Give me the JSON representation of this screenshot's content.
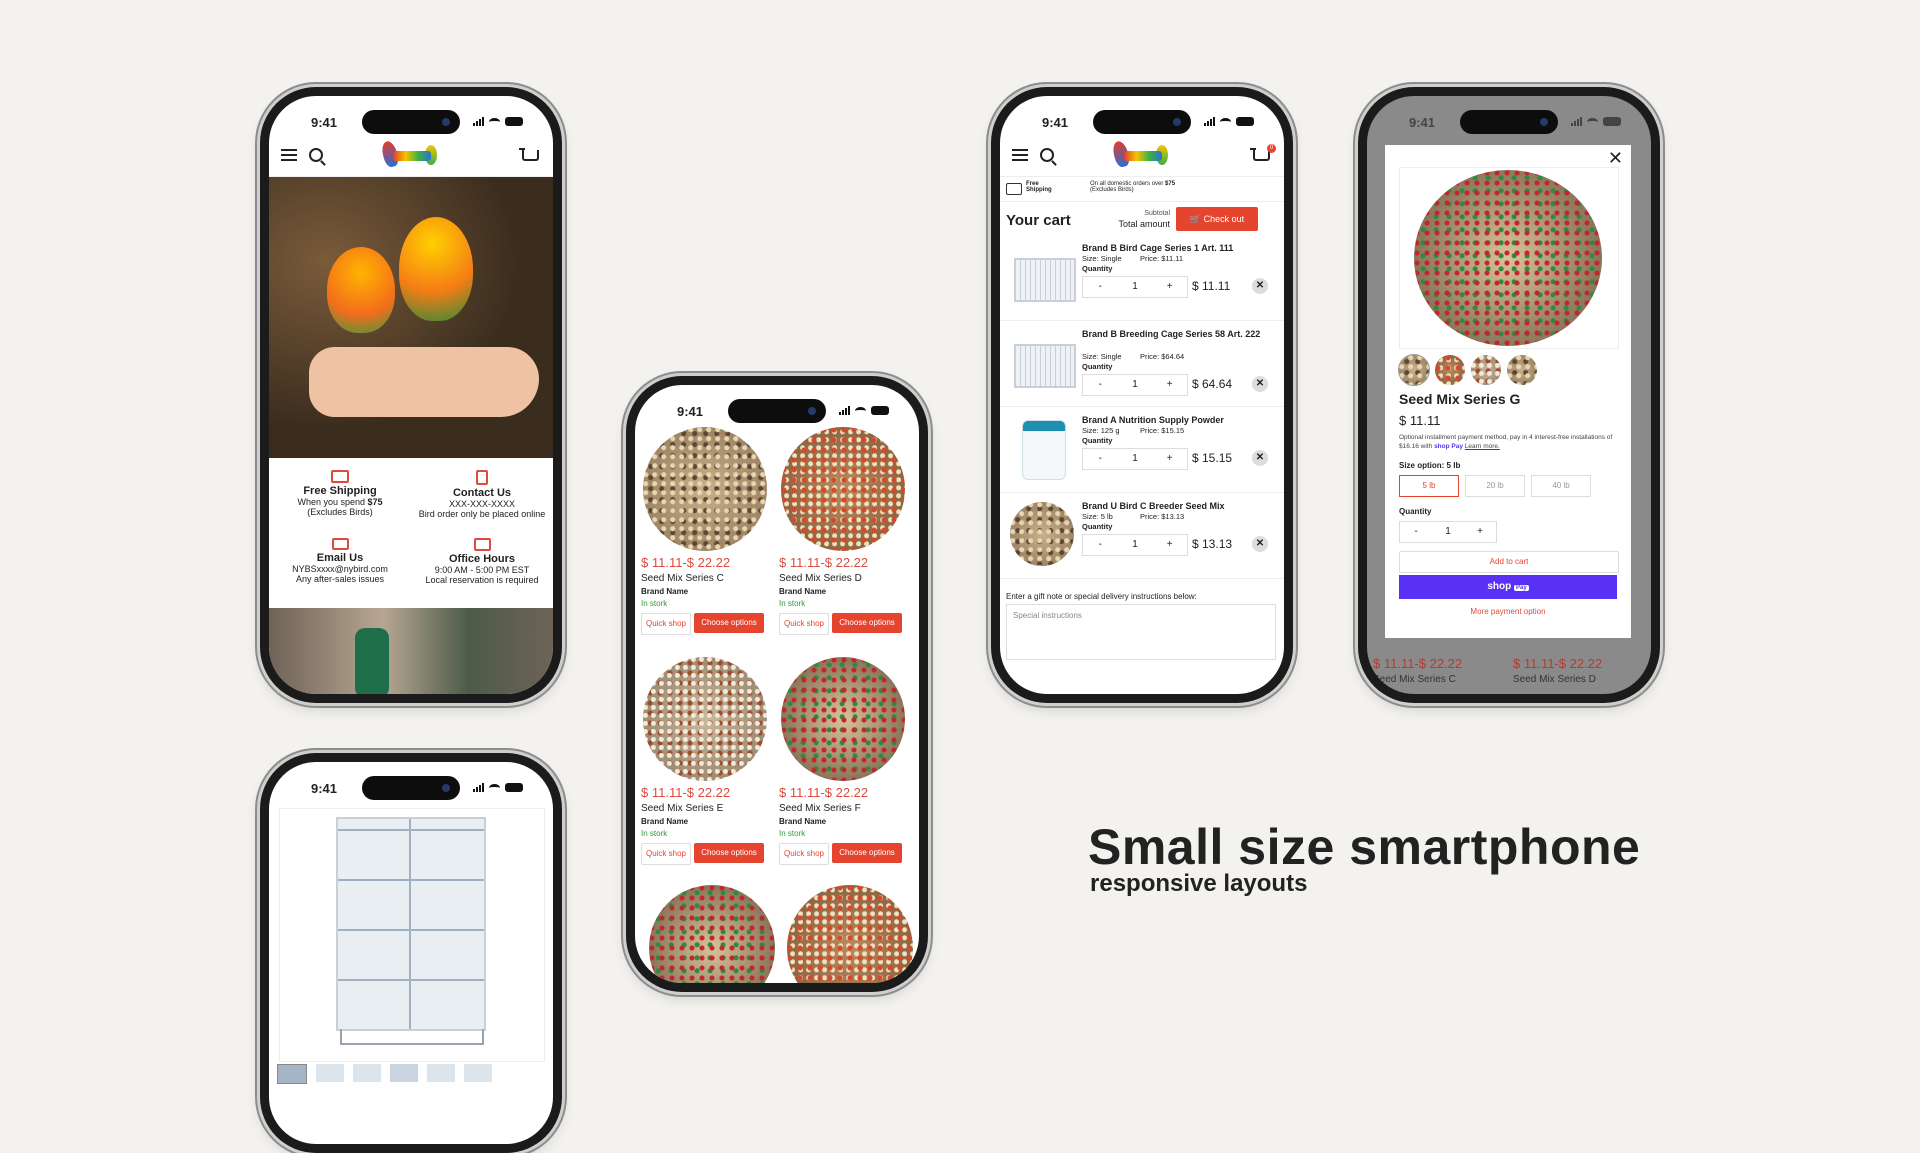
{
  "phone1": {
    "status_time": "9:41",
    "features": [
      {
        "icon": "truck-icon",
        "title": "Free Shipping",
        "line1a": "When you spend ",
        "line1b": "$75",
        "line2": "(Excludes Birds)"
      },
      {
        "icon": "phone-icon",
        "title": "Contact Us",
        "line1a": "XXX-XXX-XXXX",
        "line1b": "",
        "line2": "Bird order only be placed online"
      },
      {
        "icon": "email-icon",
        "title": "Email Us",
        "line1a": "NYBSxxxx@nybird.com",
        "line1b": "",
        "line2": "Any after-sales issues"
      },
      {
        "icon": "store-icon",
        "title": "Office Hours",
        "line1a": "9:00 AM - 5:00 PM EST",
        "line1b": "",
        "line2": "Local reservation is required"
      }
    ]
  },
  "phone2": {
    "status_time": "9:41",
    "products": [
      {
        "price": "$ 11.11-$ 22.22",
        "name": "Seed Mix Series C",
        "brand": "Brand Name",
        "stock": "In stork",
        "quick": "Quick shop",
        "choose": "Choose options",
        "img": "s1"
      },
      {
        "price": "$ 11.11-$ 22.22",
        "name": "Seed Mix Series D",
        "brand": "Brand Name",
        "stock": "In stork",
        "quick": "Quick shop",
        "choose": "Choose options",
        "img": "s2"
      },
      {
        "price": "$ 11.11-$ 22.22",
        "name": "Seed Mix Series E",
        "brand": "Brand Name",
        "stock": "In stork",
        "quick": "Quick shop",
        "choose": "Choose options",
        "img": "s3"
      },
      {
        "price": "$ 11.11-$ 22.22",
        "name": "Seed Mix Series F",
        "brand": "Brand Name",
        "stock": "In stork",
        "quick": "Quick shop",
        "choose": "Choose options",
        "img": "s4"
      }
    ]
  },
  "phone3": {
    "status_time": "9:41",
    "cart_badge": "0",
    "ship_title": "Free Shipping",
    "ship_note_a": "On all domestic orders over ",
    "ship_note_b": "$75",
    "ship_note_c": "(Excludes Birds)",
    "title": "Your cart",
    "subtotal_label": "Subtotal",
    "total_label": "Total amount",
    "checkout": "Check out",
    "items": [
      {
        "name": "Brand B Bird Cage Series 1 Art. 111",
        "size": "Size: Single",
        "price": "Price: $11.11",
        "qty_label": "Quantity",
        "qty": "1",
        "total": "$ 11.11"
      },
      {
        "name": "Brand B Breeding Cage Series 58 Art. 222",
        "size": "Size: Single",
        "price": "Price: $64.64",
        "qty_label": "Quantity",
        "qty": "1",
        "total": "$ 64.64"
      },
      {
        "name": "Brand A Nutrition Supply Powder",
        "size": "Size: 125 g",
        "price": "Price: $15.15",
        "qty_label": "Quantity",
        "qty": "1",
        "total": "$ 15.15"
      },
      {
        "name": "Brand U Bird C Breeder Seed Mix",
        "size": "Size: 5 lb",
        "price": "Price: $13.13",
        "qty_label": "Quantity",
        "qty": "1",
        "total": "$ 13.13"
      }
    ],
    "minus": "-",
    "plus": "+",
    "remove": "✕",
    "gift_label": "Enter a gift note or special delivery instructions below:",
    "gift_placeholder": "Special instructions"
  },
  "phone4": {
    "status_time": "9:41",
    "title": "Seed Mix Series G",
    "price": "$ 11.11",
    "installment": "Optional installment payment method, pay in 4 interest-free installations of $16.16 with",
    "shop_badge": "shop Pay",
    "learn_more": "Learn more.",
    "size_label": "Size option: 5 lb",
    "sizes": [
      "5 lb",
      "20 lb",
      "40 lb"
    ],
    "qty_label": "Quantity",
    "qty": "1",
    "minus": "-",
    "plus": "+",
    "add_to_cart": "Add to cart",
    "shop_pay": "shop",
    "shop_pay_tag": "Pay",
    "more_payment": "More payment option",
    "bg_prices": [
      "$ 11.11-$ 22.22",
      "$ 11.11-$ 22.22"
    ],
    "bg_names": [
      "Seed Mix Series C",
      "Seed Mix Series D"
    ]
  },
  "phone5": {
    "status_time": "9:41"
  },
  "heading": "Small size smartphone",
  "subheading": "responsive layouts"
}
